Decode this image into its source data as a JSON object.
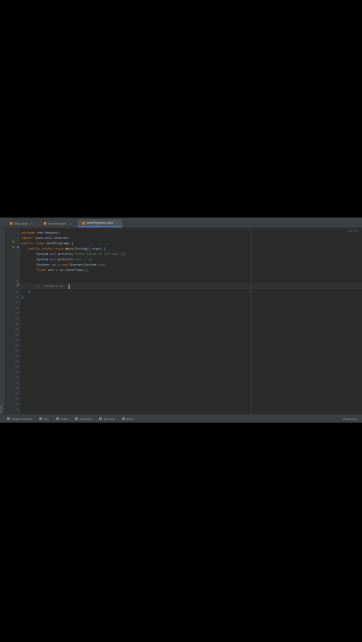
{
  "tabs": [
    {
      "label": "Main.java",
      "active": false
    },
    {
      "label": "Scanner.java",
      "active": false
    },
    {
      "label": "JavaPrograms.java",
      "active": true
    }
  ],
  "code": {
    "line1": [
      "package",
      " com.company;"
    ],
    "line2": [
      "import",
      " java.util.Scanner;"
    ],
    "line3": [
      "public class",
      " JavaPrograms {"
    ],
    "line4": [
      "public static void",
      " main",
      "(String[] args) {"
    ],
    "line5": [
      "System.",
      "out",
      ".println(",
      "\"Enter value of the one \"",
      ");"
    ],
    "line6": [
      "System.",
      "out",
      ".println(",
      "\"one : \"",
      ");"
    ],
    "line7": [
      "Scanner sc = ",
      "new",
      " Scanner(System.",
      "in",
      ");"
    ],
    "line8": [
      "float",
      " one = sc.nextFloat();"
    ],
    "line9": [
      "//",
      "  formula of"
    ],
    "line10": [
      "}"
    ],
    "line11": [
      "}"
    ]
  },
  "line_numbers": [
    "1",
    "2",
    "3",
    "4",
    "5",
    "6",
    "7",
    "8",
    "9",
    "10",
    "11",
    "12",
    "13",
    "14",
    "15",
    "16",
    "17",
    "18",
    "19",
    "20",
    "21",
    "22",
    "23",
    "24",
    "25",
    "26",
    "27",
    "28",
    "29",
    "30",
    "31",
    "32",
    "33",
    "34"
  ],
  "inspection": "⚠ 1 ✔ 1",
  "bottom": {
    "items": [
      "Version Control",
      "Run",
      "TODO",
      "Problems",
      "Terminal",
      "Build"
    ],
    "right": "Event Log"
  },
  "side_label": "Structure"
}
